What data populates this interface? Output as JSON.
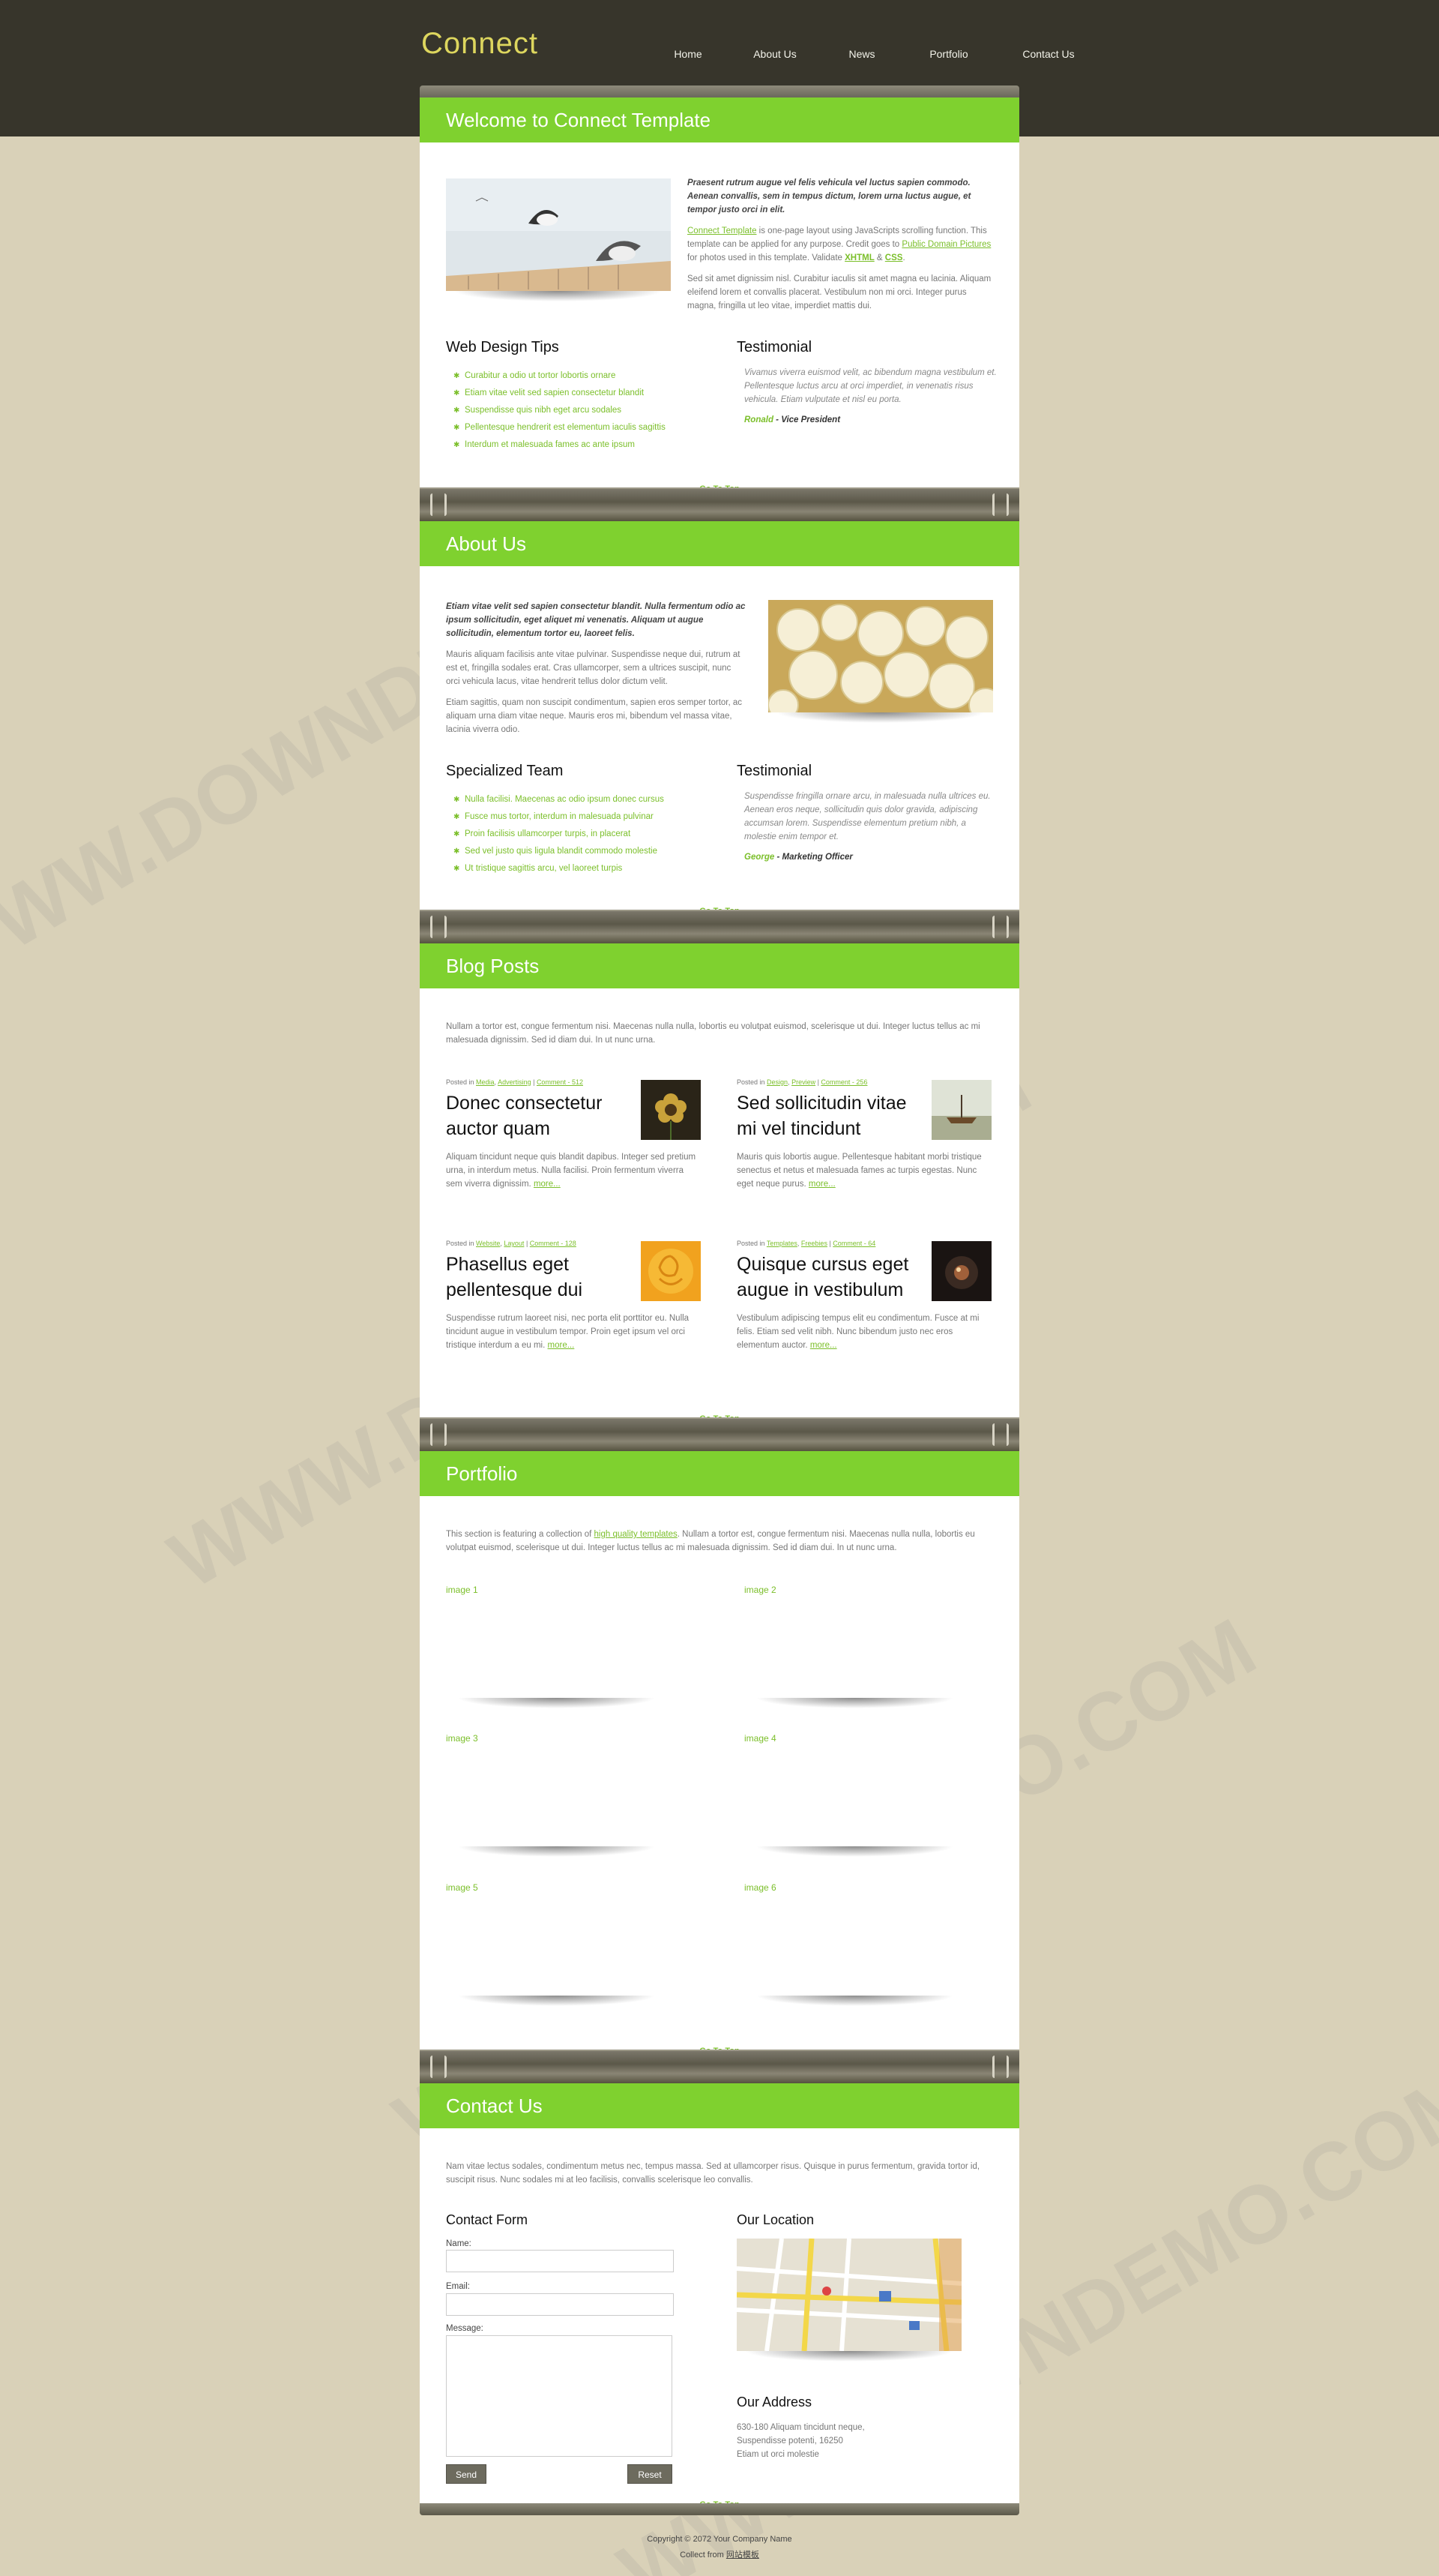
{
  "header": {
    "logo": "Connect",
    "nav": [
      "Home",
      "About Us",
      "News",
      "Portfolio",
      "Contact Us"
    ]
  },
  "goto_top": "Go To Top",
  "welcome": {
    "title": "Welcome to Connect Template",
    "intro_bold": "Praesent rutrum augue vel felis vehicula vel luctus sapien commodo. Aenean convallis, sem in tempus dictum, lorem urna luctus augue, et tempor justo orci in elit.",
    "p1_link": "Connect Template",
    "p1_a": " is one-page layout using JavaScripts scrolling function. This template can be applied for any purpose. Credit goes to ",
    "p1_link2": "Public Domain Pictures",
    "p1_b": " for photos used in this template. Validate ",
    "p1_xhtml": "XHTML",
    "p1_and": " & ",
    "p1_css": "CSS",
    "p1_end": ".",
    "p2": "Sed sit amet dignissim nisl. Curabitur iaculis sit amet magna eu lacinia. Aliquam eleifend lorem et convallis placerat. Vestibulum non mi orci. Integer purus magna, fringilla ut leo vitae, imperdiet mattis dui.",
    "tips_title": "Web Design Tips",
    "tips": [
      "Curabitur a odio ut tortor lobortis ornare",
      "Etiam vitae velit sed sapien consectetur blandit",
      "Suspendisse quis nibh eget arcu sodales",
      "Pellentesque hendrerit est elementum iaculis sagittis",
      "Interdum et malesuada fames ac ante ipsum"
    ],
    "testimonial_title": "Testimonial",
    "testimonial": "Vivamus viverra euismod velit, ac bibendum magna vestibulum et. Pellentesque luctus arcu at orci imperdiet, in venenatis risus vehicula. Etiam vulputate et nisl eu porta.",
    "testimonial_name": "Ronald",
    "testimonial_role": " - Vice President"
  },
  "about": {
    "title": "About Us",
    "intro_bold": "Etiam vitae velit sed sapien consectetur blandit. Nulla fermentum odio ac ipsum sollicitudin, eget aliquet mi venenatis. Aliquam ut augue sollicitudin, elementum tortor eu, laoreet felis.",
    "p1": "Mauris aliquam facilisis ante vitae pulvinar. Suspendisse neque dui, rutrum at est et, fringilla sodales erat. Cras ullamcorper, sem a ultrices suscipit, nunc orci vehicula lacus, vitae hendrerit tellus dolor dictum velit.",
    "p2": "Etiam sagittis, quam non suscipit condimentum, sapien eros semper tortor, ac aliquam urna diam vitae neque. Mauris eros mi, bibendum vel massa vitae, lacinia viverra odio.",
    "team_title": "Specialized Team",
    "team": [
      "Nulla facilisi. Maecenas ac odio ipsum donec cursus",
      "Fusce mus tortor, interdum in malesuada pulvinar",
      "Proin facilisis ullamcorper turpis, in placerat",
      "Sed vel justo quis ligula blandit commodo molestie",
      "Ut tristique sagittis arcu, vel laoreet turpis"
    ],
    "testimonial_title": "Testimonial",
    "testimonial": "Suspendisse fringilla ornare arcu, in malesuada nulla ultrices eu. Aenean eros neque, sollicitudin quis dolor gravida, adipiscing accumsan lorem. Suspendisse elementum pretium nibh, a molestie enim tempor et.",
    "testimonial_name": "George",
    "testimonial_role": " - Marketing Officer"
  },
  "blog": {
    "title": "Blog Posts",
    "intro": "Nullam a tortor est, congue fermentum nisi. Maecenas nulla nulla, lobortis eu volutpat euismod, scelerisque ut dui. Integer luctus tellus ac mi malesuada dignissim. Sed id diam dui. In ut nunc urna.",
    "posts": [
      {
        "posted": "Posted in ",
        "cat1": "Media",
        "sep": ", ",
        "cat2": "Advertising",
        "bar": " | ",
        "comments": "Comment - 512",
        "title": "Donec consectetur auctor quam",
        "body": "Aliquam tincidunt neque quis blandit dapibus. Integer sed pretium urna, in interdum metus. Nulla facilisi. Proin fermentum viverra sem viverra dignissim.",
        "more": "more..."
      },
      {
        "posted": "Posted in ",
        "cat1": "Design",
        "sep": ", ",
        "cat2": "Preview",
        "bar": " | ",
        "comments": "Comment - 256",
        "title": "Sed sollicitudin vitae mi vel tincidunt",
        "body": "Mauris quis lobortis augue. Pellentesque habitant morbi tristique senectus et netus et malesuada fames ac turpis egestas. Nunc eget neque purus.",
        "more": "more..."
      },
      {
        "posted": "Posted in ",
        "cat1": "Website",
        "sep": ", ",
        "cat2": "Layout",
        "bar": " | ",
        "comments": "Comment - 128",
        "title": "Phasellus eget pellentesque dui",
        "body": "Suspendisse rutrum laoreet nisi, nec porta elit porttitor eu. Nulla tincidunt augue in vestibulum tempor. Proin eget ipsum vel orci tristique interdum a eu mi.",
        "more": "more..."
      },
      {
        "posted": "Posted in ",
        "cat1": "Templates",
        "sep": ", ",
        "cat2": "Freebies",
        "bar": " | ",
        "comments": "Comment - 64",
        "title": "Quisque cursus eget augue in vestibulum",
        "body": "Vestibulum adipiscing tempus elit eu condimentum. Fusce at mi felis. Etiam sed velit nibh. Nunc bibendum justo nec eros elementum auctor.",
        "more": "more..."
      }
    ]
  },
  "portfolio": {
    "title": "Portfolio",
    "intro_a": "This section is featuring a collection of ",
    "intro_link": "high quality templates",
    "intro_b": ". Nullam a tortor est, congue fermentum nisi. Maecenas nulla nulla, lobortis eu volutpat euismod, scelerisque ut dui. Integer luctus tellus ac mi malesuada dignissim. Sed id diam dui. In ut nunc urna.",
    "images": [
      "image 1",
      "image 2",
      "image 3",
      "image 4",
      "image 5",
      "image 6"
    ]
  },
  "contact": {
    "title": "Contact Us",
    "intro": "Nam vitae lectus sodales, condimentum metus nec, tempus massa. Sed at ullamcorper risus. Quisque in purus fermentum, gravida tortor id, suscipit risus. Nunc sodales mi at leo facilisis, convallis scelerisque leo convallis.",
    "form_title": "Contact Form",
    "name_label": "Name:",
    "email_label": "Email:",
    "message_label": "Message:",
    "send": "Send",
    "reset": "Reset",
    "location_title": "Our Location",
    "address_title": "Our Address",
    "address": [
      "630-180 Aliquam tincidunt neque,",
      "Suspendisse potenti, 16250",
      "Etiam ut orci molestie"
    ]
  },
  "footer": {
    "copyright": "Copyright © 2072 Your Company Name",
    "collect_a": "Collect from ",
    "collect_link": "网站模板"
  },
  "watermark": "WWW.DOWNDEMO.COM",
  "colors": {
    "accent": "#7fd12f",
    "header_bg": "#37352b",
    "page_bg": "#d9d1b8",
    "logo": "#ddd65e"
  }
}
